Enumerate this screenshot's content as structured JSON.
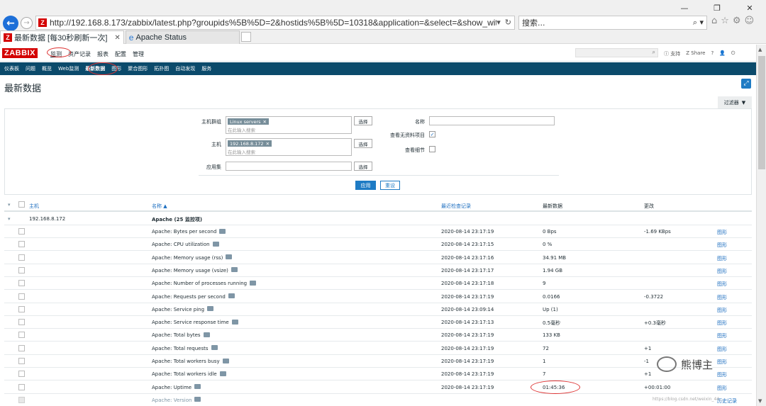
{
  "browser": {
    "url": "http://192.168.8.173/zabbix/latest.php?groupids%5B%5D=2&hostids%5B%5D=10318&application=&select=&show_without_d",
    "search_placeholder": "搜索...",
    "tabs": [
      {
        "title": "最新数据 [每30秒刷新一次]"
      },
      {
        "title": "Apache Status"
      }
    ]
  },
  "zabbix": {
    "logo": "ZABBIX",
    "topmenu": [
      "监测",
      "资产记录",
      "报表",
      "配置",
      "管理"
    ],
    "header_icons": {
      "support": "支持",
      "share": "Share",
      "help": "?"
    },
    "subnav": [
      "仪表板",
      "问题",
      "概览",
      "Web监测",
      "最新数据",
      "图形",
      "聚合图形",
      "拓扑图",
      "自动发现",
      "服务"
    ],
    "page_title": "最新数据",
    "filter_tab": "过滤器"
  },
  "filter": {
    "host_group_label": "主机群组",
    "host_group_chip": "Linux servers",
    "host_label": "主机",
    "host_chip": "192.168.8.172",
    "placeholder": "在此输入搜索",
    "app_label": "应用集",
    "select_label": "选择",
    "name_label": "名称",
    "show_without_data_label": "查看无资料项目",
    "show_details_label": "查看细节",
    "apply_label": "应用",
    "reset_label": "重设"
  },
  "table": {
    "headers": {
      "host": "主机",
      "name": "名称 ▲",
      "last_check": "最近检查记录",
      "last_value": "最新数据",
      "change": "更改"
    },
    "host_row": {
      "host": "192.168.8.172",
      "app": "Apache (25 监控项)"
    },
    "graph_label": "图形",
    "history_label": "历史记录",
    "rows": [
      {
        "name": "Apache: Bytes per second",
        "time": "2020-08-14 23:17:19",
        "value": "0 Bps",
        "change": "-1.69 KBps",
        "action": "图形"
      },
      {
        "name": "Apache: CPU utilization",
        "time": "2020-08-14 23:17:15",
        "value": "0 %",
        "change": "",
        "action": "图形"
      },
      {
        "name": "Apache: Memory usage (rss)",
        "time": "2020-08-14 23:17:16",
        "value": "34.91 MB",
        "change": "",
        "action": "图形"
      },
      {
        "name": "Apache: Memory usage (vsize)",
        "time": "2020-08-14 23:17:17",
        "value": "1.94 GB",
        "change": "",
        "action": "图形"
      },
      {
        "name": "Apache: Number of processes running",
        "time": "2020-08-14 23:17:18",
        "value": "9",
        "change": "",
        "action": "图形"
      },
      {
        "name": "Apache: Requests per second",
        "time": "2020-08-14 23:17:19",
        "value": "0.0166",
        "change": "-0.3722",
        "action": "图形"
      },
      {
        "name": "Apache: Service ping",
        "time": "2020-08-14 23:09:14",
        "value": "Up (1)",
        "change": "",
        "action": "图形"
      },
      {
        "name": "Apache: Service response time",
        "time": "2020-08-14 23:17:13",
        "value": "0.5毫秒",
        "change": "+0.3毫秒",
        "action": "图形"
      },
      {
        "name": "Apache: Total bytes",
        "time": "2020-08-14 23:17:19",
        "value": "133 KB",
        "change": "",
        "action": "图形"
      },
      {
        "name": "Apache: Total requests",
        "time": "2020-08-14 23:17:19",
        "value": "72",
        "change": "+1",
        "action": "图形"
      },
      {
        "name": "Apache: Total workers busy",
        "time": "2020-08-14 23:17:19",
        "value": "1",
        "change": "-1",
        "action": "图形"
      },
      {
        "name": "Apache: Total workers idle",
        "time": "2020-08-14 23:17:19",
        "value": "7",
        "change": "+1",
        "action": "图形"
      },
      {
        "name": "Apache: Uptime",
        "time": "2020-08-14 23:17:19",
        "value": "01:45:36",
        "change": "+00:01:00",
        "action": "图形"
      },
      {
        "name": "Apache: Version",
        "time": "",
        "value": "",
        "change": "",
        "action": "历史记录"
      }
    ]
  },
  "watermark": {
    "name": "熊博主",
    "url": "https://blog.csdn.net/weixin_44..."
  }
}
